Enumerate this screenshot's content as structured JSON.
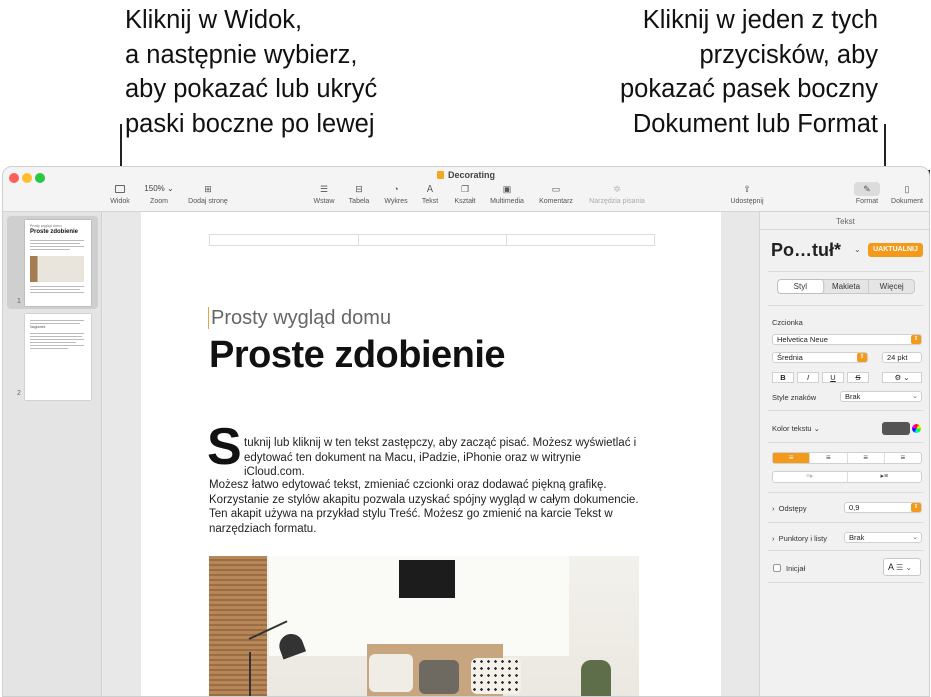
{
  "callouts": {
    "left": [
      "Kliknij w Widok,",
      "a następnie wybierz,",
      "aby pokazać lub ukryć",
      "paski boczne po lewej"
    ],
    "right": [
      "Kliknij w jeden z tych",
      "przycisków, aby",
      "pokazać pasek boczny",
      "Dokument lub Format"
    ]
  },
  "window": {
    "title": "Decorating",
    "traffic_colors": [
      "#ff5f57",
      "#febc2e",
      "#28c840"
    ]
  },
  "toolbar": {
    "view": {
      "label": "Widok",
      "icon": "sidebar-icon"
    },
    "zoom": {
      "label": "Zoom",
      "value": "150% ⌄"
    },
    "add_page": {
      "label": "Dodaj stronę",
      "icon": "plus-square-icon"
    },
    "insert": {
      "label": "Wstaw",
      "icon": "list-icon"
    },
    "table": {
      "label": "Tabela",
      "icon": "table-icon"
    },
    "chart": {
      "label": "Wykres",
      "icon": "clock-chart-icon"
    },
    "text": {
      "label": "Tekst",
      "icon": "text-box-icon"
    },
    "shape": {
      "label": "Kształt",
      "icon": "shape-icon"
    },
    "media": {
      "label": "Multimedia",
      "icon": "image-icon"
    },
    "comment": {
      "label": "Komentarz",
      "icon": "comment-icon"
    },
    "writing_tools": {
      "label": "Narzędzia pisania",
      "icon": "sparkle-icon"
    },
    "share": {
      "label": "Udostępnij",
      "icon": "share-icon"
    },
    "format": {
      "label": "Format",
      "icon": "paintbrush-icon"
    },
    "document": {
      "label": "Dokument",
      "icon": "document-icon"
    }
  },
  "sidebar": {
    "pages": [
      {
        "number": "1",
        "title": "Proste zdobienie",
        "subtitle": "Prosty wygląd domu"
      },
      {
        "number": "2",
        "heading": "Nagłówek"
      }
    ]
  },
  "document": {
    "subtitle": "Prosty wygląd domu",
    "title": "Proste zdobienie",
    "dropcap": "S",
    "para1": "tuknij lub kliknij w ten tekst zastępczy, aby zacząć pisać. Możesz wyświetlać i edytować ten dokument na Macu, iPadzie, iPhonie oraz w witrynie iCloud.com.",
    "para2": "Możesz łatwo edytować tekst, zmieniać czcionki oraz dodawać piękną grafikę. Korzystanie ze stylów akapitu pozwala uzyskać spójny wygląd w całym dokumencie. Ten akapit używa na przykład stylu Treść. Możesz go zmienić na karcie Tekst w narzędziach formatu."
  },
  "panel": {
    "tab": "Tekst",
    "style_name": "Po…tuł*",
    "update_label": "UAKTUALNIJ",
    "segments": [
      "Styl",
      "Makieta",
      "Więcej"
    ],
    "font_section": "Czcionka",
    "font_family": "Helvetica Neue",
    "font_weight": "Średnia",
    "font_size": "24 pkt",
    "format_buttons": [
      "B",
      "I",
      "U",
      "S"
    ],
    "char_styles_label": "Style znaków",
    "char_styles_value": "Brak",
    "text_color_label": "Kolor tekstu ⌄",
    "text_color": "#555555",
    "accent": "#f39a1a",
    "spacing_label": "Odstępy",
    "spacing_value": "0,9",
    "bullets_label": "Punktory i listy",
    "bullets_value": "Brak",
    "dropcap_label": "Inicjał",
    "dropcap_preview": "A"
  }
}
